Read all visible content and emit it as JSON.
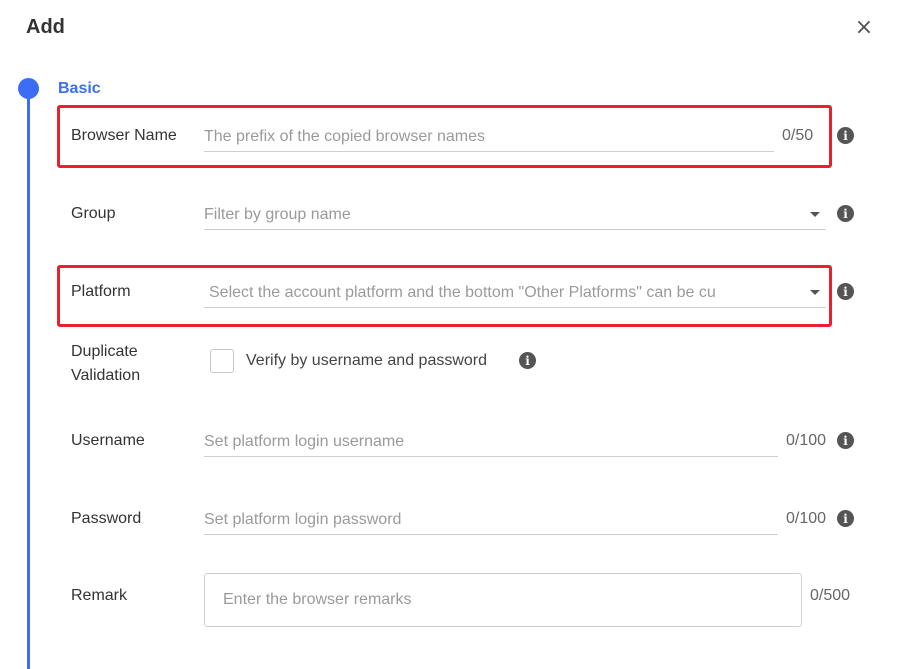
{
  "dialog": {
    "title": "Add",
    "close_symbol": "×"
  },
  "section": {
    "label": "Basic"
  },
  "fields": {
    "browser_name": {
      "label": "Browser Name",
      "placeholder": "The prefix of the copied browser names",
      "counter": "0/50"
    },
    "group": {
      "label": "Group",
      "placeholder": "Filter by group name"
    },
    "platform": {
      "label": "Platform",
      "placeholder": "Select the account platform and the bottom \"Other Platforms\" can be cu"
    },
    "duplicate_validation": {
      "label_line1": "Duplicate",
      "label_line2": "Validation",
      "checkbox_label": "Verify by username and password",
      "checked": false
    },
    "username": {
      "label": "Username",
      "placeholder": "Set platform login username",
      "counter": "0/100"
    },
    "password": {
      "label": "Password",
      "placeholder": "Set platform login password",
      "counter": "0/100"
    },
    "remark": {
      "label": "Remark",
      "placeholder": "Enter the browser remarks",
      "counter": "0/500"
    }
  },
  "icons": {
    "info": "info-circle-icon",
    "caret": "caret-down-icon",
    "info_glyph": "i"
  },
  "colors": {
    "accent": "#3b6ef5",
    "highlight": "#e8202f"
  }
}
